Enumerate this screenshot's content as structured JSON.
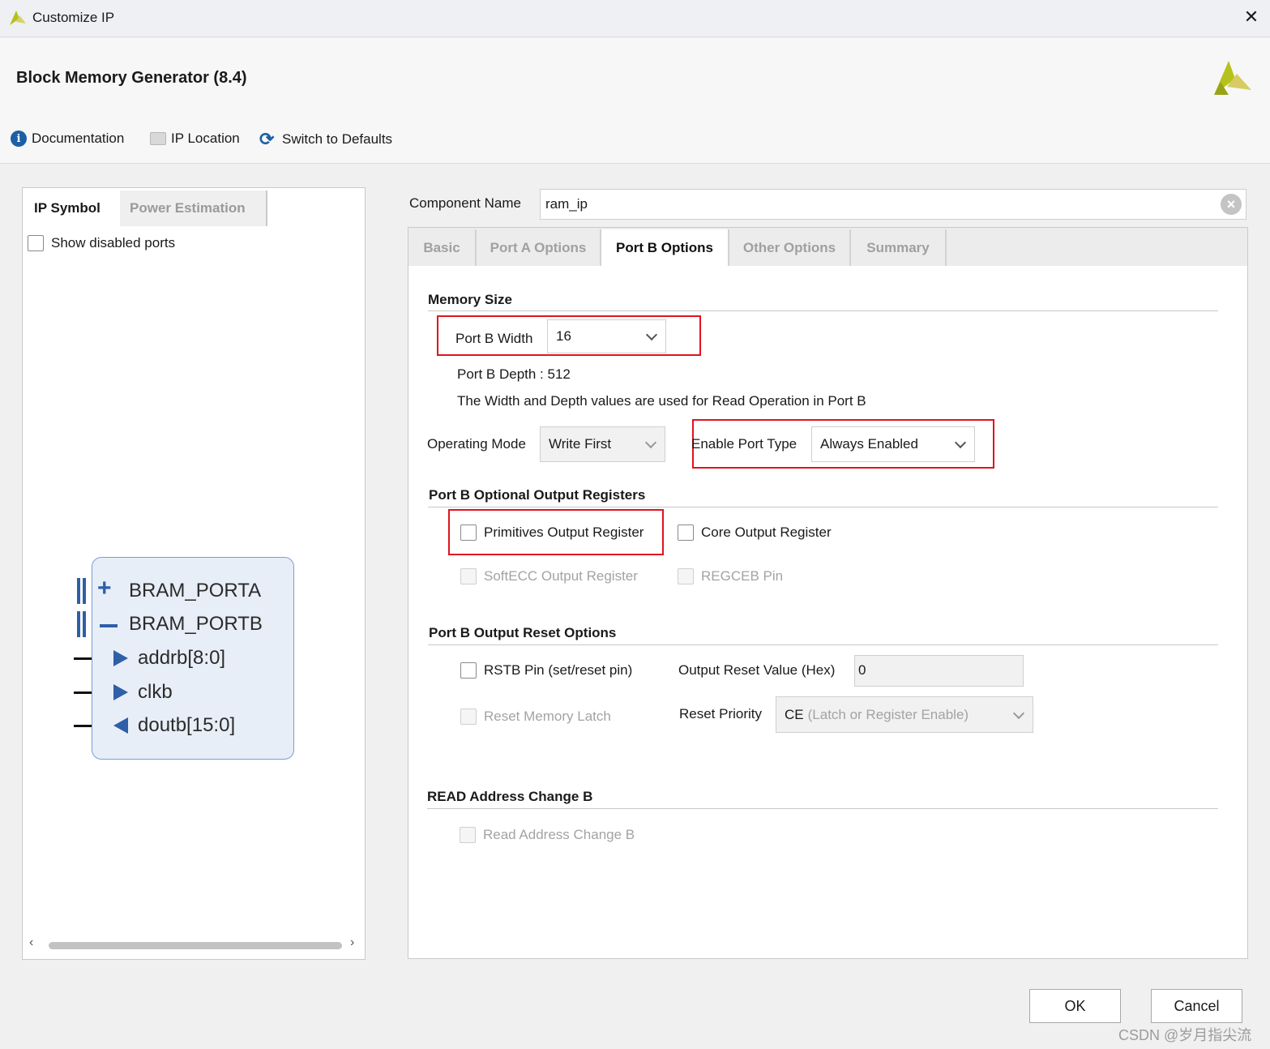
{
  "window": {
    "title": "Customize IP",
    "close_symbol": "✕"
  },
  "header": {
    "title": "Block Memory Generator (8.4)"
  },
  "toolbar": {
    "documentation": "Documentation",
    "ip_location": "IP Location",
    "switch_defaults": "Switch to Defaults"
  },
  "left_panel": {
    "tabs": [
      "IP Symbol",
      "Power Estimation"
    ],
    "show_disabled_ports": "Show disabled ports",
    "symbol": {
      "ports": [
        "BRAM_PORTA",
        "BRAM_PORTB",
        "addrb[8:0]",
        "clkb",
        "doutb[15:0]"
      ]
    }
  },
  "component": {
    "label": "Component Name",
    "value": "ram_ip"
  },
  "tabs": [
    "Basic",
    "Port A Options",
    "Port B Options",
    "Other Options",
    "Summary"
  ],
  "memory_size": {
    "section": "Memory Size",
    "port_b_width_label": "Port B Width",
    "port_b_width_value": "16",
    "port_b_depth": "Port B Depth : 512",
    "note": "The Width and Depth values are used for Read Operation in Port B",
    "operating_mode_label": "Operating Mode",
    "operating_mode_value": "Write First",
    "enable_port_type_label": "Enable Port Type",
    "enable_port_type_value": "Always Enabled"
  },
  "optional_output": {
    "section": "Port B Optional Output Registers",
    "primitives": "Primitives Output Register",
    "core": "Core Output Register",
    "softecc": "SoftECC Output Register",
    "regceb": "REGCEB Pin"
  },
  "reset_options": {
    "section": "Port B Output Reset Options",
    "rstb": "RSTB Pin (set/reset pin)",
    "reset_value_label": "Output Reset Value (Hex)",
    "reset_value": "0",
    "reset_memory_latch": "Reset Memory Latch",
    "reset_priority_label": "Reset Priority",
    "reset_priority_ce": "CE",
    "reset_priority_rest": "(Latch or Register Enable)"
  },
  "read_address": {
    "section": "READ Address Change B",
    "checkbox": "Read Address Change B"
  },
  "buttons": {
    "ok": "OK",
    "cancel": "Cancel"
  },
  "watermark": "CSDN @岁月指尖流",
  "colors": {
    "accent_blue": "#2e5fa8",
    "highlight_red": "#e0141e",
    "logo_yellow": "#b5c21b"
  }
}
